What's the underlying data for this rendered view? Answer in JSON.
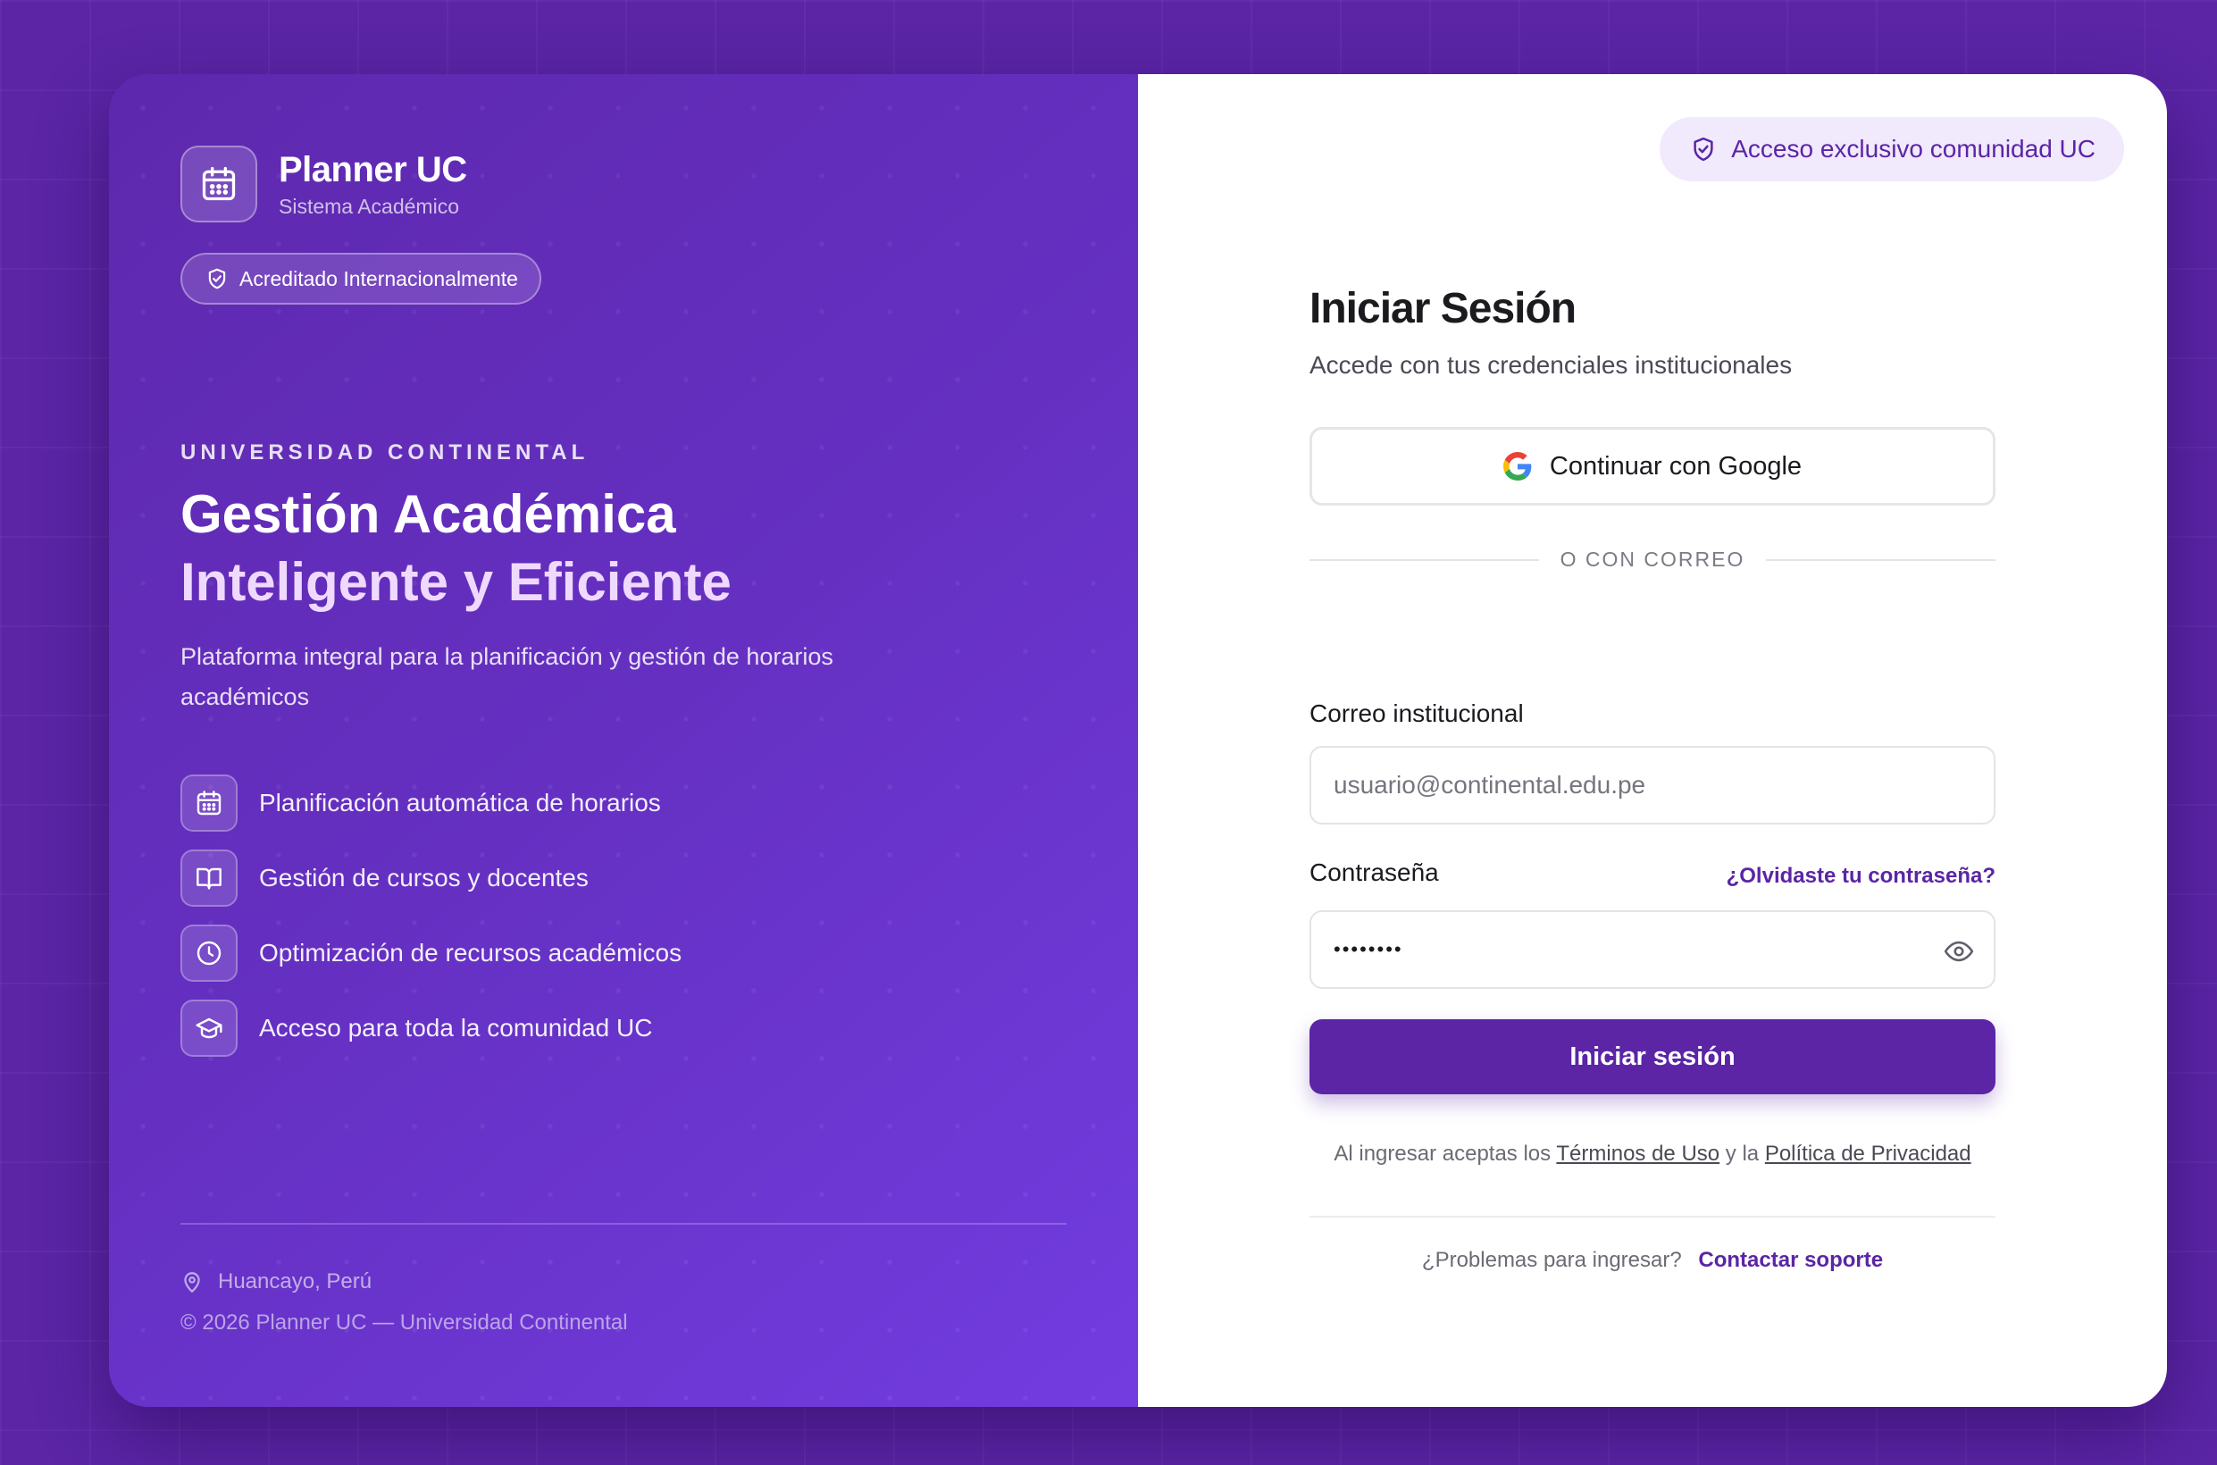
{
  "brand": {
    "title": "Planner UC",
    "subtitle": "Sistema Académico",
    "icon": "calendar-icon"
  },
  "badge": {
    "label": "Acreditado Internacionalmente",
    "icon": "shield-check-icon"
  },
  "hero": {
    "eyebrow": "UNIVERSIDAD CONTINENTAL",
    "title_line1": "Gestión Académica",
    "title_line2": "Inteligente y Eficiente",
    "description": "Plataforma integral para la planificación y gestión de horarios académicos"
  },
  "features": [
    {
      "icon": "calendar-icon",
      "label": "Planificación automática de horarios"
    },
    {
      "icon": "book-open-icon",
      "label": "Gestión de cursos y docentes"
    },
    {
      "icon": "clock-icon",
      "label": "Optimización de recursos académicos"
    },
    {
      "icon": "graduation-cap-icon",
      "label": "Acceso para toda la comunidad UC"
    }
  ],
  "footer": {
    "location": "Huancayo, Perú",
    "copyright": "© 2026 Planner UC — Universidad Continental"
  },
  "access_badge": {
    "label": "Acceso exclusivo comunidad UC",
    "icon": "shield-check-icon"
  },
  "login": {
    "title": "Iniciar Sesión",
    "subtitle": "Accede con tus credenciales institucionales",
    "google_button": "Continuar con Google",
    "divider": "O CON CORREO",
    "email_label": "Correo institucional",
    "email_placeholder": "usuario@continental.edu.pe",
    "email_value": "",
    "password_label": "Contraseña",
    "forgot_link": "¿Olvidaste tu contraseña?",
    "password_value": "••••••••",
    "submit": "Iniciar sesión",
    "terms_prefix": "Al ingresar aceptas los",
    "terms_link": "Términos de Uso",
    "terms_and": "y la",
    "privacy_link": "Política de Privacidad",
    "support_question": "¿Problemas para ingresar?",
    "support_link": "Contactar soporte"
  },
  "colors": {
    "brand_purple": "#5b25a6",
    "panel_gradient_start": "#5e28ad",
    "panel_gradient_end": "#723ce0",
    "badge_bg": "#f1e9fc",
    "accent_light": "#f0d9ff"
  }
}
